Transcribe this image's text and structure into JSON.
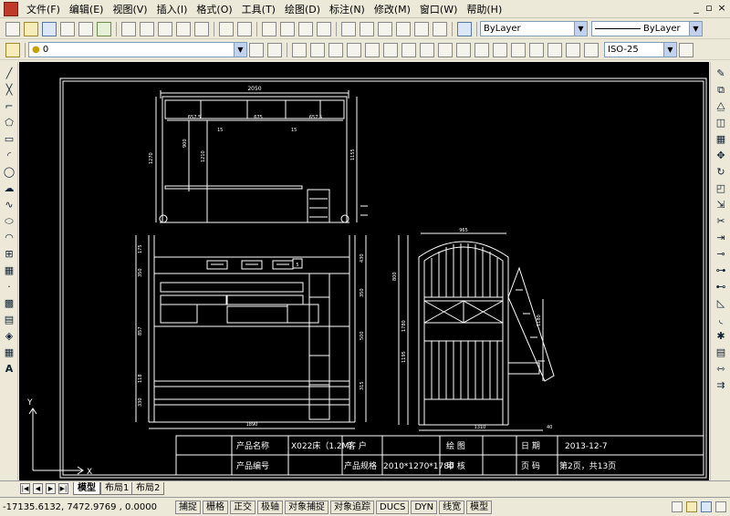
{
  "menu": [
    "文件(F)",
    "编辑(E)",
    "视图(V)",
    "插入(I)",
    "格式(O)",
    "工具(T)",
    "绘图(D)",
    "标注(N)",
    "修改(M)",
    "窗口(W)",
    "帮助(H)"
  ],
  "toolbar": {
    "color_combo": "ByLayer",
    "linetype_combo": "ByLayer",
    "layer_combo": "0",
    "dimstyle_combo": "ISO-25"
  },
  "tabs": {
    "model": "模型",
    "layout1": "布局1",
    "layout2": "布局2"
  },
  "status": {
    "coords": "-17135.6132, 7472.9769 , 0.0000",
    "buttons": [
      "捕捉",
      "栅格",
      "正交",
      "极轴",
      "对象捕捉",
      "对象追踪",
      "DUCS",
      "DYN",
      "线宽",
      "模型"
    ]
  },
  "drawing": {
    "dims": {
      "top_width": "2050",
      "top_left_rail": "657.5",
      "top_mid_rail": "675",
      "top_right_rail": "657.5",
      "top_c1": "15",
      "top_c2": "15",
      "top_h_total": "1270",
      "top_h_inner": "900",
      "top_h_mid": "1210",
      "top_h_right": "1155",
      "front_width": "1890",
      "front_h1": "175",
      "front_h2": "350",
      "front_h3": "857",
      "front_h4": "118",
      "front_h5": "330",
      "front_r1": "430",
      "front_r2": "350",
      "front_r3": "500",
      "front_r4": "315",
      "front_box": "5",
      "side_width_top": "965",
      "side_width_bottom": "1310",
      "side_h1": "800",
      "side_h2": "1780",
      "side_h3": "1195",
      "side_h4": "1180",
      "side_h5": "40"
    },
    "titleblock": {
      "product_name_label": "产品名称",
      "product_name_value": "X022床（1.2M）",
      "customer_label": "客  户",
      "drawing_label": "绘    图",
      "date_label": "日    期",
      "date_value": "2013-12-7",
      "product_no_label": "产品编号",
      "spec_label": "产品规格",
      "spec_value": "2010*1270*1780",
      "review_label": "审    核",
      "page_label": "页    码",
      "page_value": "第2页，共13页"
    },
    "ucs": {
      "y": "Y",
      "x": "X"
    }
  }
}
